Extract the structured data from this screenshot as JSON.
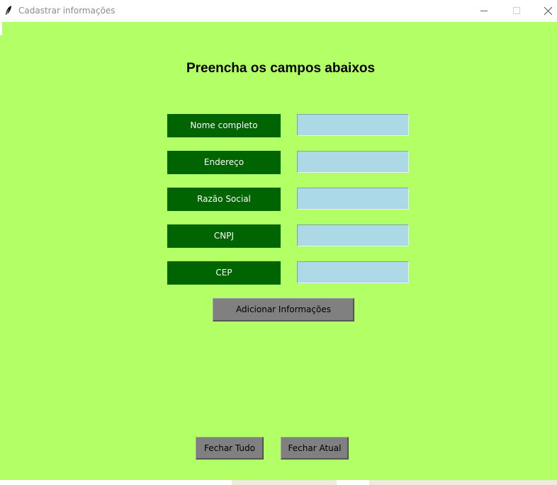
{
  "window": {
    "title": "Cadastrar informações",
    "background": "#b3ff66",
    "icon": "feather-icon"
  },
  "form": {
    "heading": "Preencha os campos abaixos",
    "fields": [
      {
        "label": "Nome completo",
        "value": ""
      },
      {
        "label": "Endereço",
        "value": ""
      },
      {
        "label": "Razão Social",
        "value": ""
      },
      {
        "label": "CNPJ",
        "value": ""
      },
      {
        "label": "CEP",
        "value": ""
      }
    ],
    "label_color": "#006400",
    "input_color": "#add8e6"
  },
  "buttons": {
    "add": "Adicionar Informações",
    "close_all": "Fechar Tudo",
    "close_current": "Fechar Atual",
    "color": "#808080"
  }
}
